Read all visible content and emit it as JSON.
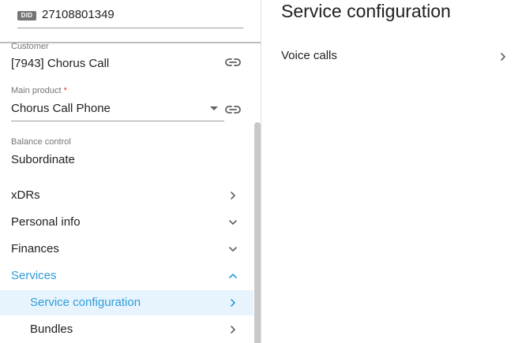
{
  "header": {
    "did_badge": "DID",
    "did_value": "27108801349"
  },
  "fields": {
    "customer_label": "Customer",
    "customer_value": "[7943] Chorus Call",
    "main_product_label": "Main product",
    "main_product_required": "*",
    "main_product_value": "Chorus Call  Phone",
    "balance_control_label": "Balance control",
    "balance_control_value": "Subordinate"
  },
  "nav": {
    "items": [
      {
        "label": "xDRs",
        "icon": "chevron-right-icon"
      },
      {
        "label": "Personal info",
        "icon": "chevron-down-icon"
      },
      {
        "label": "Finances",
        "icon": "chevron-down-icon"
      },
      {
        "label": "Services",
        "icon": "chevron-up-icon"
      }
    ],
    "sub_items": [
      {
        "label": "Service configuration",
        "icon": "chevron-right-icon",
        "selected": true
      },
      {
        "label": "Bundles",
        "icon": "chevron-right-icon",
        "selected": false
      }
    ]
  },
  "main": {
    "title": "Service configuration",
    "items": [
      {
        "label": "Voice calls",
        "icon": "chevron-right-icon"
      }
    ]
  },
  "colors": {
    "accent": "#2d9cdb",
    "selected_bg": "#e8f4fd",
    "text": "#212121",
    "muted": "#757575"
  }
}
